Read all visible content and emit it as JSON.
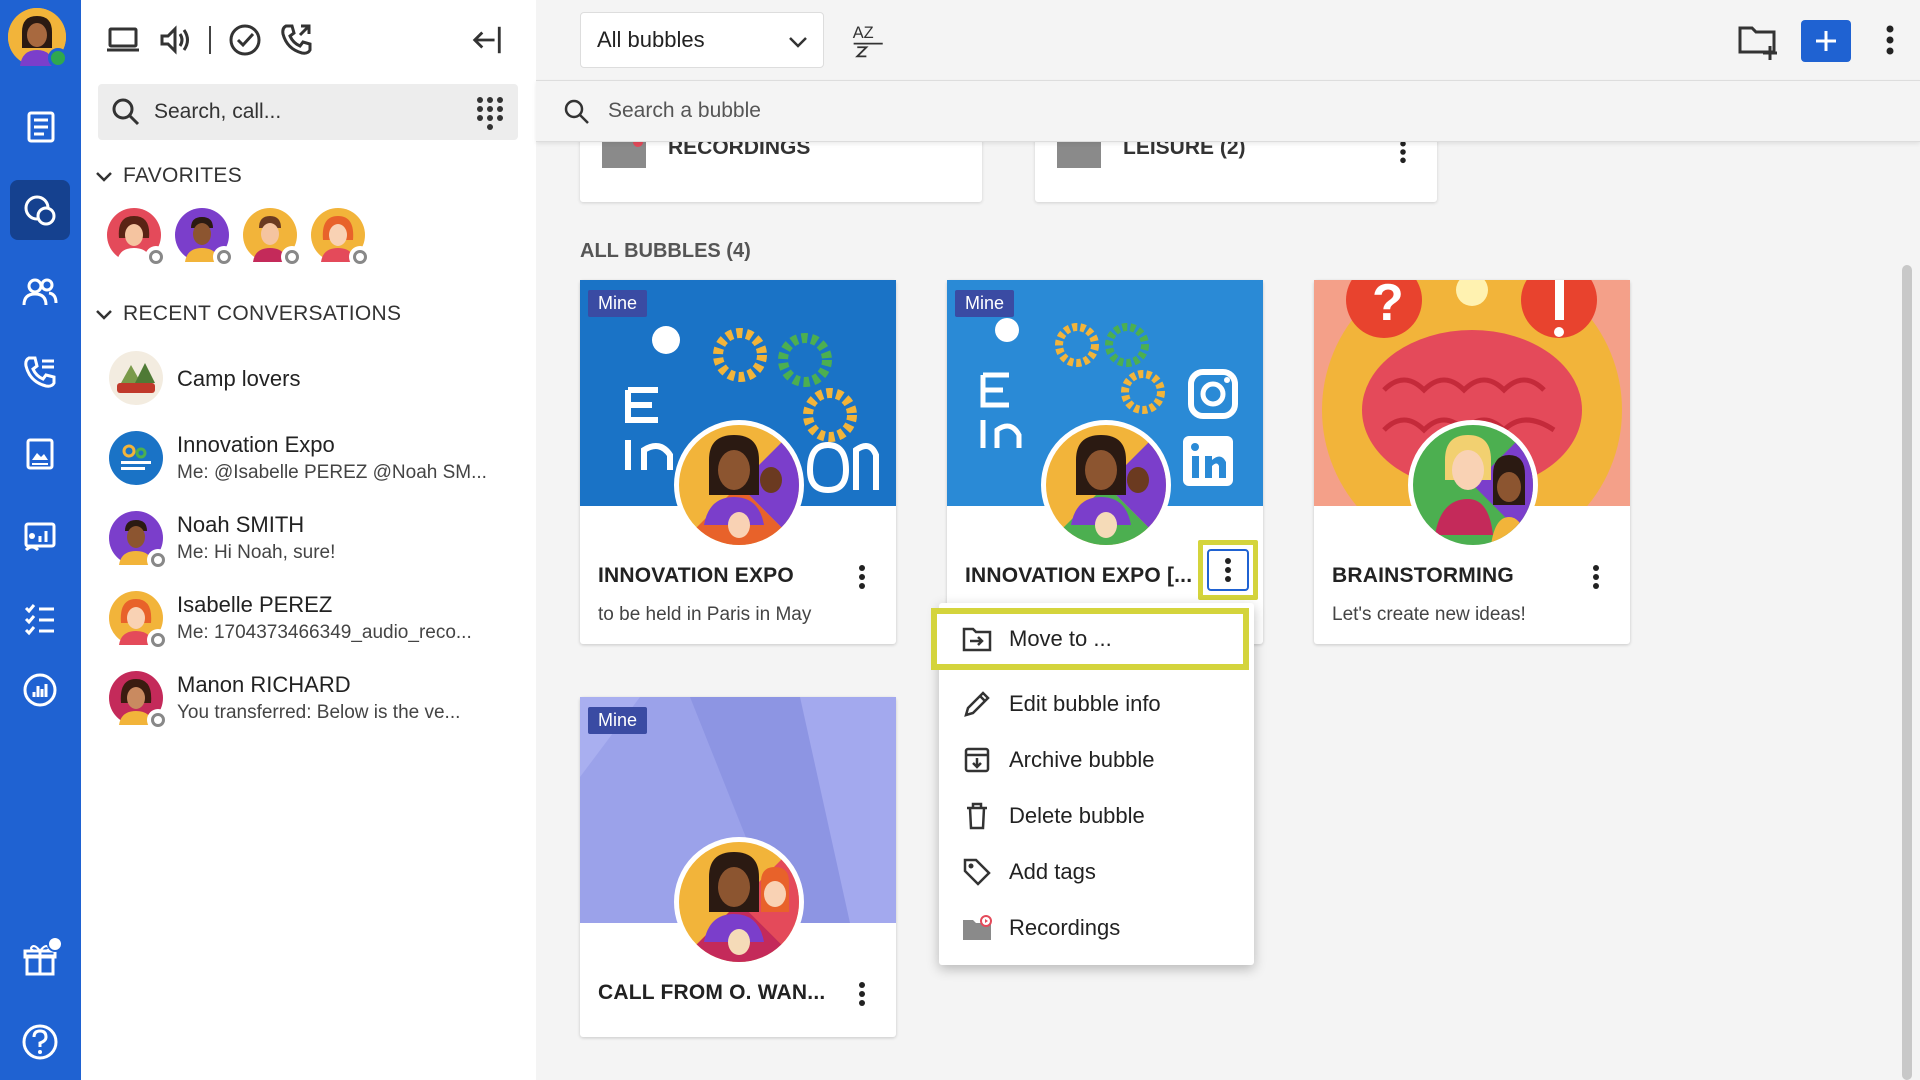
{
  "rail": {
    "items": [
      "news-icon",
      "bubbles-icon",
      "contacts-icon",
      "calls-icon",
      "files-icon",
      "dashboard-icon",
      "tasks-icon",
      "analytics-icon",
      "gift-icon",
      "help-icon"
    ],
    "active": "bubbles-icon",
    "colors": {
      "background": "#1f62d2",
      "active": "#15418f"
    }
  },
  "panel": {
    "search_placeholder": "Search, call...",
    "favorites_title": "FAVORITES",
    "recent_title": "RECENT CONVERSATIONS",
    "conversations": [
      {
        "name": "Camp lovers",
        "last": ""
      },
      {
        "name": "Innovation Expo",
        "last": "Me: @Isabelle PEREZ @Noah SM..."
      },
      {
        "name": "Noah SMITH",
        "last": "Me: Hi Noah, sure!"
      },
      {
        "name": "Isabelle PEREZ",
        "last": "Me: 1704373466349_audio_reco..."
      },
      {
        "name": "Manon RICHARD",
        "last": "You transferred: Below is the ve..."
      }
    ]
  },
  "main": {
    "filter_value": "All bubbles",
    "sort_label": "AZ",
    "search_placeholder": "Search a bubble",
    "folders": [
      {
        "name": "RECORDINGS"
      },
      {
        "name": "LEISURE (2)"
      }
    ],
    "all_title": "ALL BUBBLES (4)",
    "mine_label": "Mine",
    "bubbles": [
      {
        "title": "INNOVATION EXPO",
        "desc": "to be held in Paris in May"
      },
      {
        "title": "INNOVATION EXPO [...",
        "desc": ""
      },
      {
        "title": "BRAINSTORMING",
        "desc": "Let's create new ideas!"
      },
      {
        "title": "CALL FROM O. WAN...",
        "desc": ""
      }
    ]
  },
  "menu": {
    "items": [
      "Move to ...",
      "Edit bubble info",
      "Archive bubble",
      "Delete bubble",
      "Add tags",
      "Recordings"
    ],
    "highlight_color": "#d4d43c"
  }
}
